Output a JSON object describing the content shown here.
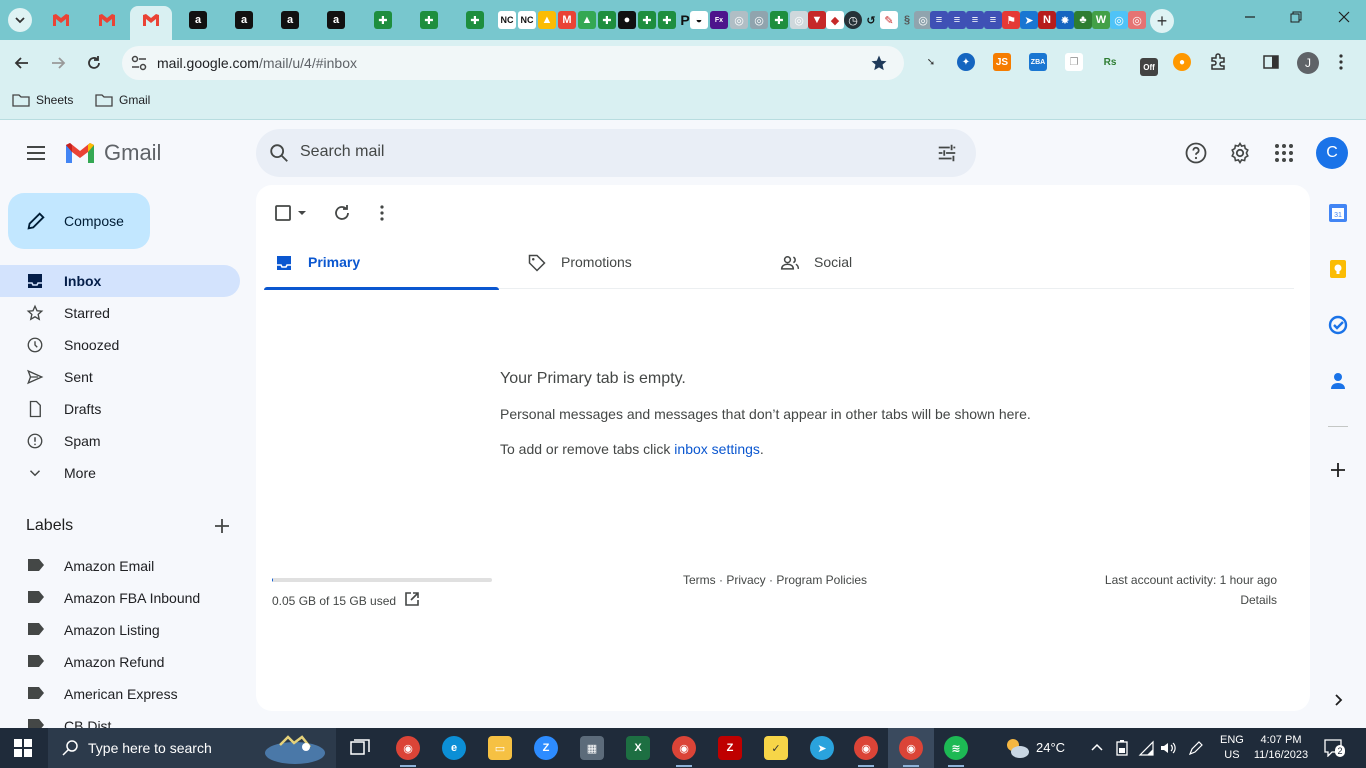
{
  "browser": {
    "url_host": "mail.google.com",
    "url_path": "/mail/u/4/#inbox",
    "profile_initial": "J",
    "tab_icon_letters": [
      "NC",
      "NC",
      "P",
      "a",
      "a",
      "a",
      "a"
    ],
    "bookmarks": [
      {
        "label": "Sheets",
        "icon": "folder-icon"
      },
      {
        "label": "Gmail",
        "icon": "folder-icon"
      }
    ],
    "extension_labels": [
      "JS",
      "ZBA",
      "Rs",
      "Off"
    ],
    "colors": {
      "tabstrip": "#78c7ce",
      "toolbar": "#d9f0f2"
    }
  },
  "gmail": {
    "brand": "Gmail",
    "search_placeholder": "Search mail",
    "account_initial": "C",
    "compose_label": "Compose",
    "nav": [
      {
        "label": "Inbox",
        "icon": "inbox-icon",
        "active": true
      },
      {
        "label": "Starred",
        "icon": "star-icon"
      },
      {
        "label": "Snoozed",
        "icon": "clock-icon"
      },
      {
        "label": "Sent",
        "icon": "send-icon"
      },
      {
        "label": "Drafts",
        "icon": "draft-icon"
      },
      {
        "label": "Spam",
        "icon": "spam-icon"
      },
      {
        "label": "More",
        "icon": "chevron-down-icon"
      }
    ],
    "labels_header": "Labels",
    "labels": [
      "Amazon Email",
      "Amazon FBA Inbound",
      "Amazon Listing",
      "Amazon Refund",
      "American Express",
      "CB Dist"
    ],
    "inbox_tabs": [
      {
        "label": "Primary",
        "icon": "inbox-icon",
        "active": true
      },
      {
        "label": "Promotions",
        "icon": "tag-icon"
      },
      {
        "label": "Social",
        "icon": "people-icon"
      }
    ],
    "empty": {
      "title": "Your Primary tab is empty.",
      "description": "Personal messages and messages that don’t appear in other tabs will be shown here.",
      "hint_prefix": "To add or remove tabs click ",
      "hint_link": "inbox settings",
      "hint_suffix": "."
    },
    "storage": {
      "text": "0.05 GB of 15 GB used",
      "used_fraction": 0.0033
    },
    "footer": {
      "links": "Terms · Privacy · Program Policies",
      "last_activity": "Last account activity: 1 hour ago",
      "details": "Details"
    },
    "side_panel": [
      "calendar-icon",
      "keep-icon",
      "tasks-icon",
      "contacts-icon",
      "add-icon"
    ],
    "colors": {
      "compose_bg": "#c2e7ff",
      "active_nav": "#d3e3fd",
      "accent": "#0b57d0",
      "avatar": "#1a73e8"
    }
  },
  "taskbar": {
    "search_placeholder": "Type here to search",
    "temperature": "24°C",
    "lang_line1": "ENG",
    "lang_line2": "US",
    "time": "4:07 PM",
    "date": "11/16/2023",
    "notification_count": "2"
  }
}
